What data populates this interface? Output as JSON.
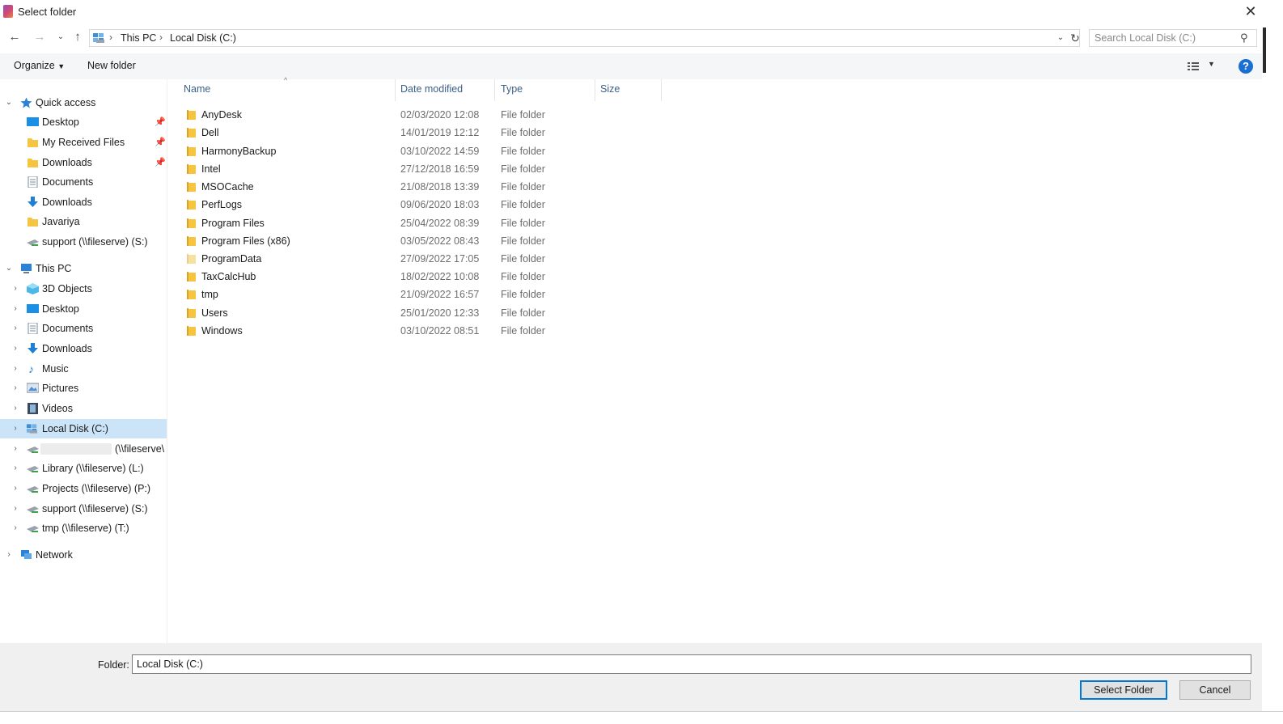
{
  "window": {
    "title": "Select folder"
  },
  "address": {
    "crumbs": [
      "This PC",
      "Local Disk (C:)"
    ],
    "search_placeholder": "Search Local Disk (C:)"
  },
  "toolbar": {
    "organize": "Organize",
    "new_folder": "New folder",
    "help": "?"
  },
  "sidebar": {
    "quick_access": {
      "label": "Quick access",
      "items": [
        {
          "label": "Desktop",
          "icon": "desktop-icon",
          "pinned": true
        },
        {
          "label": "My Received Files",
          "icon": "folder-icon",
          "pinned": true
        },
        {
          "label": "Downloads",
          "icon": "folder-icon",
          "pinned": true
        },
        {
          "label": "Documents",
          "icon": "documents-icon",
          "pinned": false
        },
        {
          "label": "Downloads",
          "icon": "downloads-icon",
          "pinned": false
        },
        {
          "label": "Javariya",
          "icon": "folder-icon",
          "pinned": false
        },
        {
          "label": "support (\\\\fileserve) (S:)",
          "icon": "network-drive-icon",
          "pinned": false
        }
      ]
    },
    "this_pc": {
      "label": "This PC",
      "items": [
        {
          "label": "3D Objects",
          "icon": "3d-objects-icon"
        },
        {
          "label": "Desktop",
          "icon": "desktop-icon"
        },
        {
          "label": "Documents",
          "icon": "documents-icon"
        },
        {
          "label": "Downloads",
          "icon": "downloads-icon"
        },
        {
          "label": "Music",
          "icon": "music-icon"
        },
        {
          "label": "Pictures",
          "icon": "pictures-icon"
        },
        {
          "label": "Videos",
          "icon": "videos-icon"
        },
        {
          "label": "Local Disk (C:)",
          "icon": "local-disk-icon",
          "selected": true
        },
        {
          "label": "(\\\\fileserve\\",
          "icon": "network-drive-icon",
          "redacted": true
        },
        {
          "label": "Library (\\\\fileserve) (L:)",
          "icon": "network-drive-icon"
        },
        {
          "label": "Projects (\\\\fileserve) (P:)",
          "icon": "network-drive-icon"
        },
        {
          "label": "support (\\\\fileserve) (S:)",
          "icon": "network-drive-icon"
        },
        {
          "label": "tmp (\\\\fileserve) (T:)",
          "icon": "network-drive-icon"
        }
      ]
    },
    "network": {
      "label": "Network"
    }
  },
  "columns": {
    "name": "Name",
    "date": "Date modified",
    "type": "Type",
    "size": "Size"
  },
  "files": [
    {
      "name": "AnyDesk",
      "date": "02/03/2020 12:08",
      "type": "File folder"
    },
    {
      "name": "Dell",
      "date": "14/01/2019 12:12",
      "type": "File folder"
    },
    {
      "name": "HarmonyBackup",
      "date": "03/10/2022 14:59",
      "type": "File folder"
    },
    {
      "name": "Intel",
      "date": "27/12/2018 16:59",
      "type": "File folder"
    },
    {
      "name": "MSOCache",
      "date": "21/08/2018 13:39",
      "type": "File folder"
    },
    {
      "name": "PerfLogs",
      "date": "09/06/2020 18:03",
      "type": "File folder"
    },
    {
      "name": "Program Files",
      "date": "25/04/2022 08:39",
      "type": "File folder"
    },
    {
      "name": "Program Files (x86)",
      "date": "03/05/2022 08:43",
      "type": "File folder"
    },
    {
      "name": "ProgramData",
      "date": "27/09/2022 17:05",
      "type": "File folder"
    },
    {
      "name": "TaxCalcHub",
      "date": "18/02/2022 10:08",
      "type": "File folder"
    },
    {
      "name": "tmp",
      "date": "21/09/2022 16:57",
      "type": "File folder"
    },
    {
      "name": "Users",
      "date": "25/01/2020 12:33",
      "type": "File folder"
    },
    {
      "name": "Windows",
      "date": "03/10/2022 08:51",
      "type": "File folder"
    }
  ],
  "footer": {
    "folder_label": "Folder:",
    "folder_value": "Local Disk (C:)",
    "select_button": "Select Folder",
    "cancel_button": "Cancel"
  },
  "colors": {
    "accent": "#0078d7",
    "selection": "#cce4f7",
    "folder": "#f5c542",
    "header_text": "#3a5f8a"
  }
}
